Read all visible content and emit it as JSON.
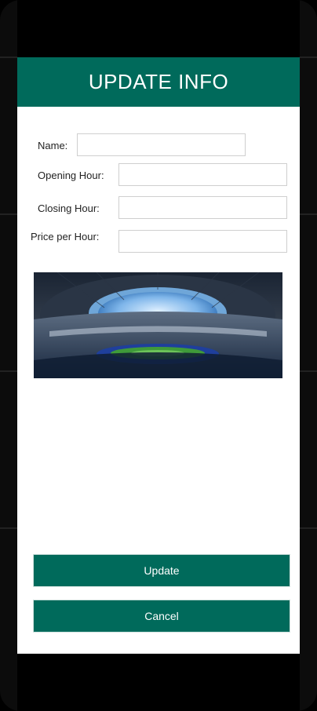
{
  "dialog": {
    "title": "UPDATE INFO"
  },
  "form": {
    "name_label": "Name:",
    "name_value": "",
    "opening_label": "Opening Hour:",
    "opening_value": "",
    "closing_label": "Closing Hour:",
    "closing_value": "",
    "price_label": "Price per Hour:",
    "price_value": ""
  },
  "buttons": {
    "update_label": "Update",
    "cancel_label": "Cancel"
  },
  "colors": {
    "primary": "#006a5b",
    "background": "#000000",
    "dialog_bg": "#ffffff"
  }
}
